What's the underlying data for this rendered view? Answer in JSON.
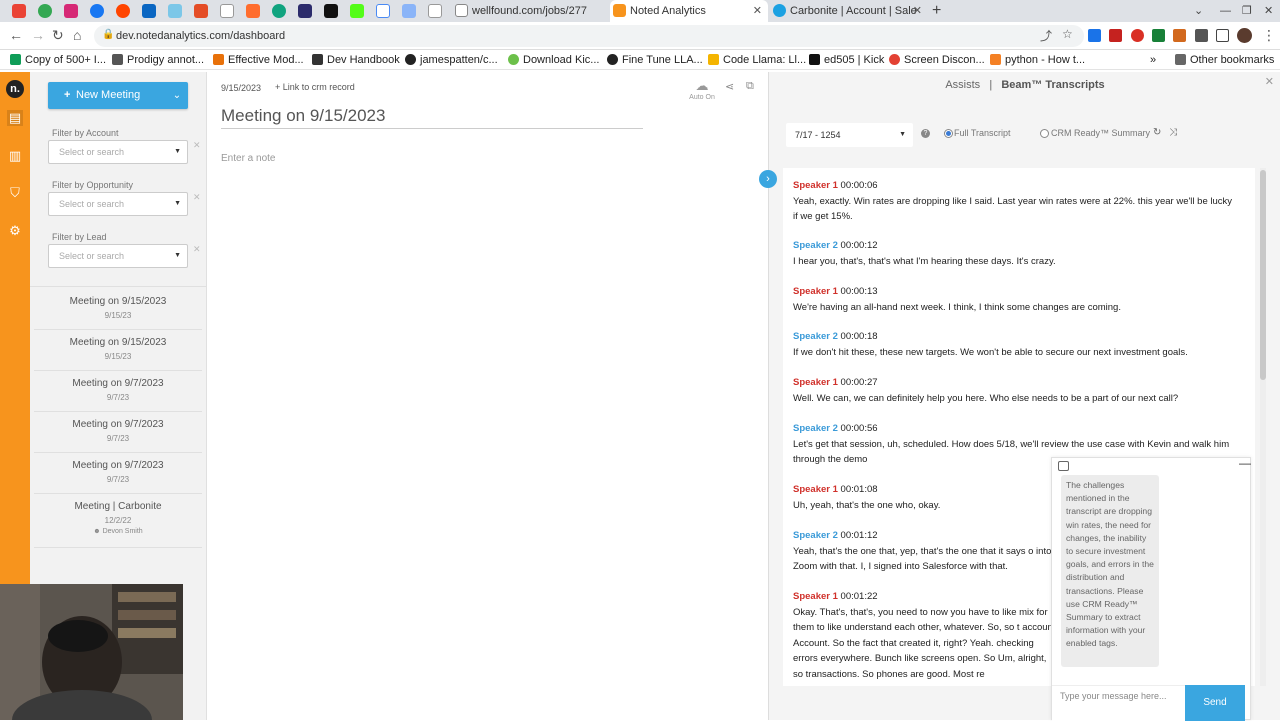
{
  "browser": {
    "tabs": [
      {
        "label": "wellfound.com/jobs/277",
        "color": "#555555"
      },
      {
        "label": "Noted Analytics",
        "color": "#f7941d"
      },
      {
        "label": "Carbonite | Account | Sale",
        "color": "#1ba1e2"
      }
    ],
    "url": "dev.notedanalytics.com/dashboard",
    "bookmarks": [
      {
        "label": "Copy of 500+ I...",
        "color": "#0f9d58"
      },
      {
        "label": "Prodigy annot...",
        "color": "#555555"
      },
      {
        "label": "Effective Mod...",
        "color": "#e8710a"
      },
      {
        "label": "Dev Handbook",
        "color": "#333333"
      },
      {
        "label": "jamespatten/c...",
        "color": "#222222"
      },
      {
        "label": "Download Kic...",
        "color": "#6cc04a"
      },
      {
        "label": "Fine Tune LLA...",
        "color": "#222222"
      },
      {
        "label": "Code Llama: Ll...",
        "color": "#f4b400"
      },
      {
        "label": "ed505 | Kick",
        "color": "#111111"
      },
      {
        "label": "Screen Discon...",
        "color": "#e34133"
      },
      {
        "label": "python - How t...",
        "color": "#f48024"
      }
    ],
    "other_bookmarks": "Other bookmarks"
  },
  "sidebar": {
    "new_meeting_label": "New Meeting",
    "filters": [
      {
        "label": "Filter by Account",
        "placeholder": "Select or search"
      },
      {
        "label": "Filter by Opportunity",
        "placeholder": "Select or search"
      },
      {
        "label": "Filter by Lead",
        "placeholder": "Select or search"
      }
    ],
    "meetings": [
      {
        "title": "Meeting on 9/15/2023",
        "date": "9/15/23"
      },
      {
        "title": "Meeting on 9/15/2023",
        "date": "9/15/23"
      },
      {
        "title": "Meeting on 9/7/2023",
        "date": "9/7/23"
      },
      {
        "title": "Meeting on 9/7/2023",
        "date": "9/7/23"
      },
      {
        "title": "Meeting on 9/7/2023",
        "date": "9/7/23"
      },
      {
        "title": "Meeting | Carbonite",
        "date": "12/2/22",
        "user": "Devon Smith"
      }
    ]
  },
  "note": {
    "date": "9/15/2023",
    "crm_link": "Link to crm record",
    "title": "Meeting on 9/15/2023",
    "placeholder": "Enter a note",
    "auto_on": "Auto On"
  },
  "beam": {
    "tab_assists": "Assists",
    "separator": "|",
    "tab_transcripts": "Beam™ Transcripts",
    "transcript_select": "7/17 - 1254",
    "option_full": "Full Transcript",
    "option_summary": "CRM Ready™ Summary",
    "entries": [
      {
        "speaker": "Speaker 1",
        "time": "00:00:06",
        "text": "Yeah, exactly. Win rates are dropping like I said. Last year win rates were at 22%. this year we'll be lucky if we get 15%."
      },
      {
        "speaker": "Speaker 2",
        "time": "00:00:12",
        "text": "I hear you, that's, that's what I'm hearing these days. It's crazy."
      },
      {
        "speaker": "Speaker 1",
        "time": "00:00:13",
        "text": "We're having an all-hand next week. I think, I think some changes are coming."
      },
      {
        "speaker": "Speaker 2",
        "time": "00:00:18",
        "text": "If we don't hit these, these new targets. We won't be able to secure our next investment goals."
      },
      {
        "speaker": "Speaker 1",
        "time": "00:00:27",
        "text": "Well. We can, we can definitely help you here. Who else needs to be a part of our next call?"
      },
      {
        "speaker": "Speaker 2",
        "time": "00:00:56",
        "text": "Let's get that session, uh, scheduled. How does 5/18, we'll review the use case with Kevin and walk him through the demo"
      },
      {
        "speaker": "Speaker 1",
        "time": "00:01:08",
        "text": "Uh, yeah, that's the one who, okay."
      },
      {
        "speaker": "Speaker 2",
        "time": "00:01:12",
        "text": "Yeah, that's the one that, yep, that's the one that it says o into Zoom with that. I, I signed into Salesforce with that."
      },
      {
        "speaker": "Speaker 1",
        "time": "00:01:22",
        "text": "Okay. That's, that's, you need to now you have to like mix for them to like understand each other, whatever. So, so t account Account. So the fact that created it, right? Yeah. checking errors everywhere. Bunch like screens open. So Um, alright, so transactions. So phones are good. Most re"
      }
    ]
  },
  "chat": {
    "message": "The challenges mentioned in the transcript are dropping win rates, the need for changes, the inability to secure investment goals, and errors in the distribution and transactions. Please use CRM Ready™ Summary to extract information with your enabled tags.",
    "input_placeholder": "Type your message here...",
    "send_label": "Send"
  },
  "colors": {
    "brand_orange": "#f7941d",
    "accent_blue": "#3aa6e0",
    "speaker1": "#d0302a",
    "speaker2": "#3a9ad8"
  }
}
